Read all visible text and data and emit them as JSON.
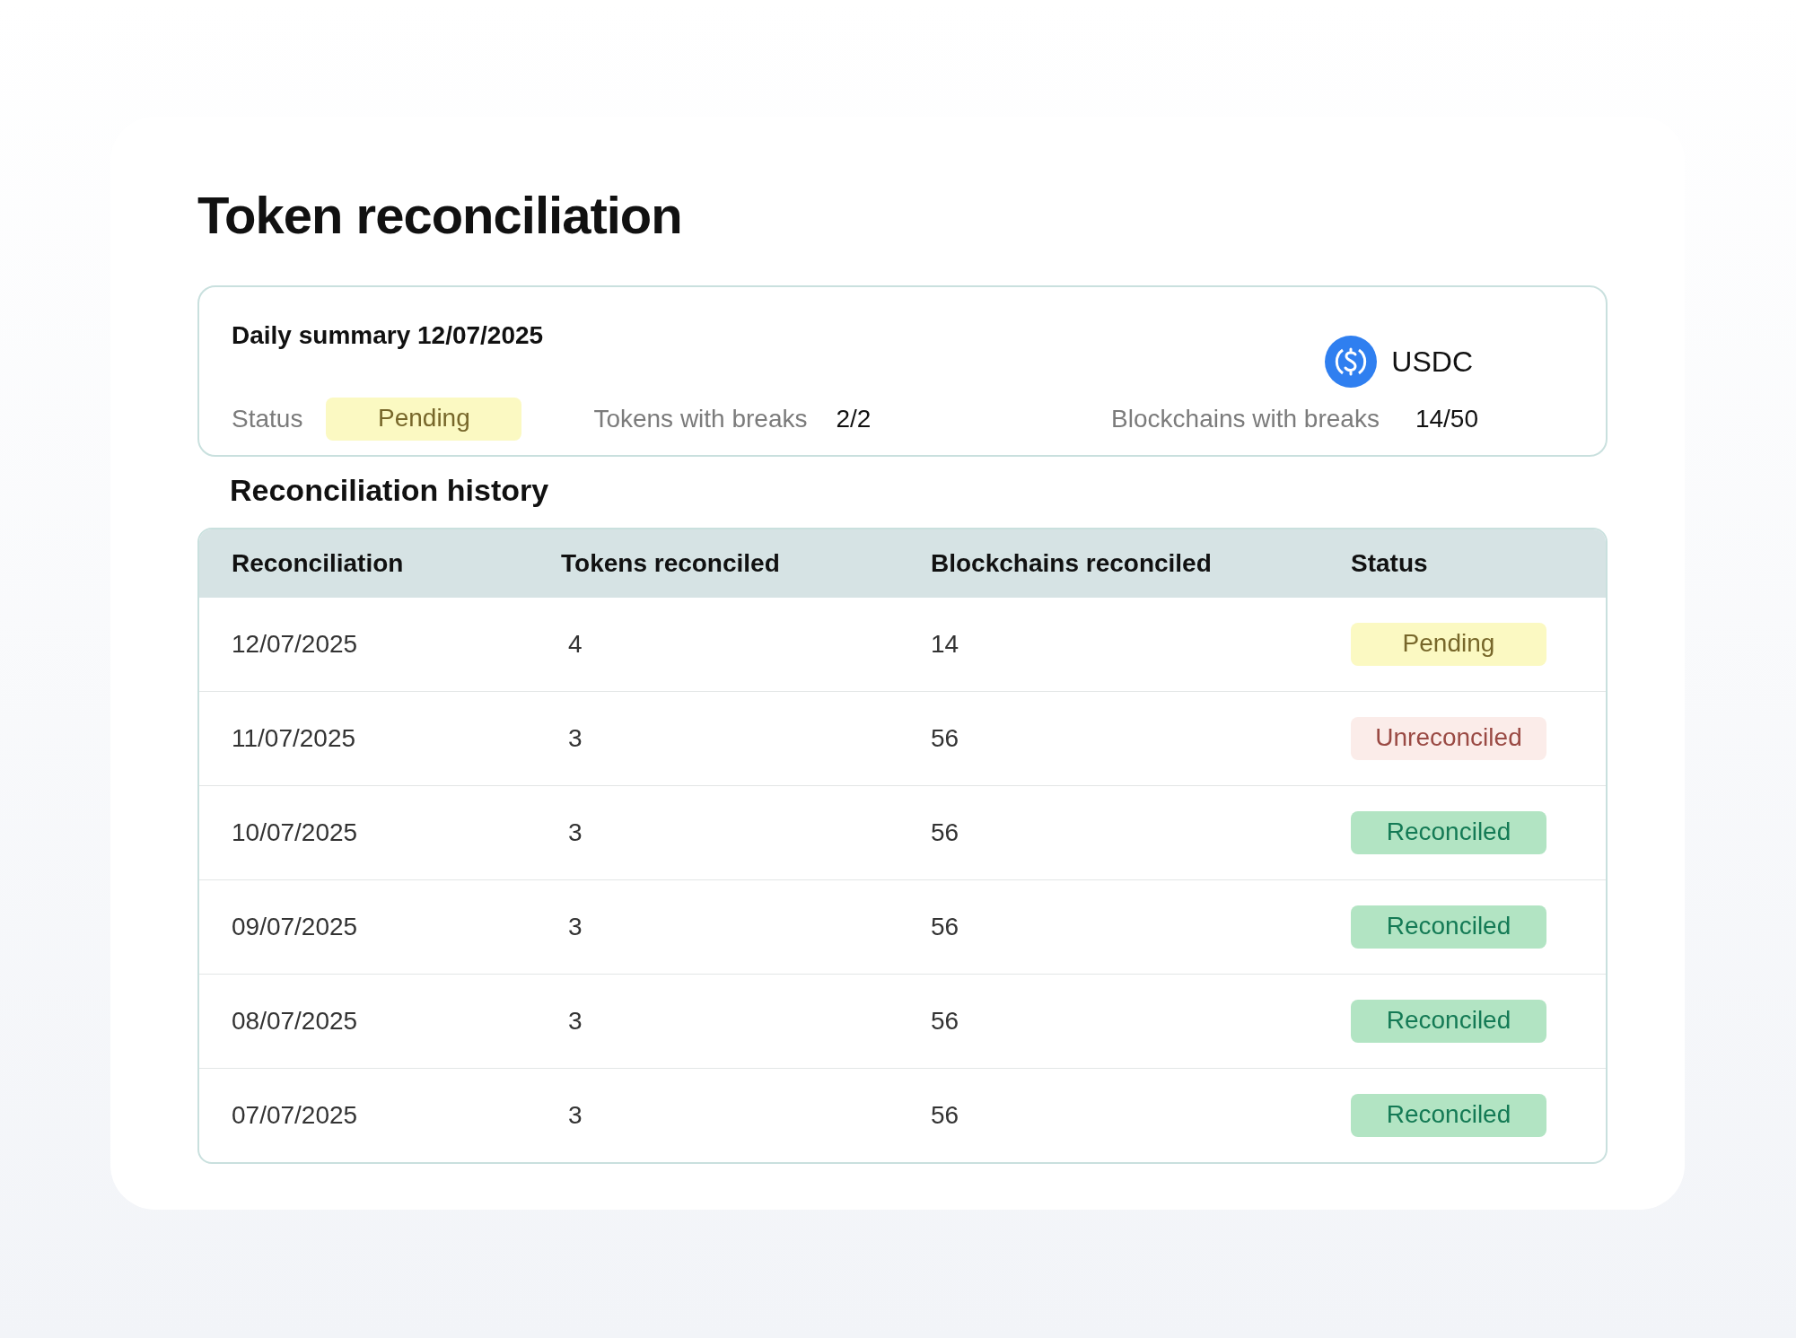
{
  "title": "Token reconciliation",
  "summary": {
    "heading": "Daily summary 12/07/2025",
    "token": "USDC",
    "status_label": "Status",
    "status": {
      "text": "Pending",
      "kind": "pending"
    },
    "tokens_label": "Tokens with breaks",
    "tokens_value": "2/2",
    "chains_label": "Blockchains with breaks",
    "chains_value": "14/50"
  },
  "history": {
    "heading": "Reconciliation history",
    "columns": [
      "Reconciliation",
      "Tokens reconciled",
      "Blockchains reconciled",
      "Status"
    ],
    "rows": [
      {
        "date": "12/07/2025",
        "tokens": "4",
        "chains": "14",
        "status": {
          "text": "Pending",
          "kind": "pending"
        }
      },
      {
        "date": "11/07/2025",
        "tokens": "3",
        "chains": "56",
        "status": {
          "text": "Unreconciled",
          "kind": "unreconciled"
        }
      },
      {
        "date": "10/07/2025",
        "tokens": "3",
        "chains": "56",
        "status": {
          "text": "Reconciled",
          "kind": "reconciled"
        }
      },
      {
        "date": "09/07/2025",
        "tokens": "3",
        "chains": "56",
        "status": {
          "text": "Reconciled",
          "kind": "reconciled"
        }
      },
      {
        "date": "08/07/2025",
        "tokens": "3",
        "chains": "56",
        "status": {
          "text": "Reconciled",
          "kind": "reconciled"
        }
      },
      {
        "date": "07/07/2025",
        "tokens": "3",
        "chains": "56",
        "status": {
          "text": "Reconciled",
          "kind": "reconciled"
        }
      }
    ]
  }
}
